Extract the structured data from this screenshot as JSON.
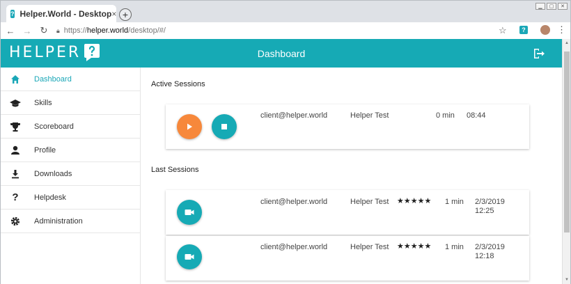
{
  "browser": {
    "tab_title": "Helper.World - Desktop",
    "tab_close": "×",
    "new_tab": "+",
    "url_scheme": "https://",
    "url_host": "helper.world",
    "url_path": "/desktop/#/"
  },
  "header": {
    "logo_text": "HELPER",
    "title": "Dashboard"
  },
  "sidebar": {
    "items": [
      {
        "label": "Dashboard",
        "icon": "home-icon",
        "active": true
      },
      {
        "label": "Skills",
        "icon": "graduation-cap-icon"
      },
      {
        "label": "Scoreboard",
        "icon": "trophy-icon"
      },
      {
        "label": "Profile",
        "icon": "person-icon"
      },
      {
        "label": "Downloads",
        "icon": "download-icon"
      },
      {
        "label": "Helpdesk",
        "icon": "question-icon"
      },
      {
        "label": "Administration",
        "icon": "gear-icon"
      }
    ]
  },
  "active_sessions": {
    "title": "Active Sessions",
    "rows": [
      {
        "client": "client@helper.world",
        "helper": "Helper Test",
        "duration": "0 min",
        "time": "08:44"
      }
    ]
  },
  "last_sessions": {
    "title": "Last Sessions",
    "rows": [
      {
        "client": "client@helper.world",
        "helper": "Helper Test",
        "rating": 5,
        "stars": "★★★★★",
        "duration": "1 min",
        "date": "2/3/2019",
        "time": "12:25"
      },
      {
        "client": "client@helper.world",
        "helper": "Helper Test",
        "rating": 5,
        "stars": "★★★★★",
        "duration": "1 min",
        "date": "2/3/2019",
        "time": "12:18"
      }
    ]
  },
  "colors": {
    "primary": "#16aab5",
    "accent_orange": "#f7883b"
  }
}
